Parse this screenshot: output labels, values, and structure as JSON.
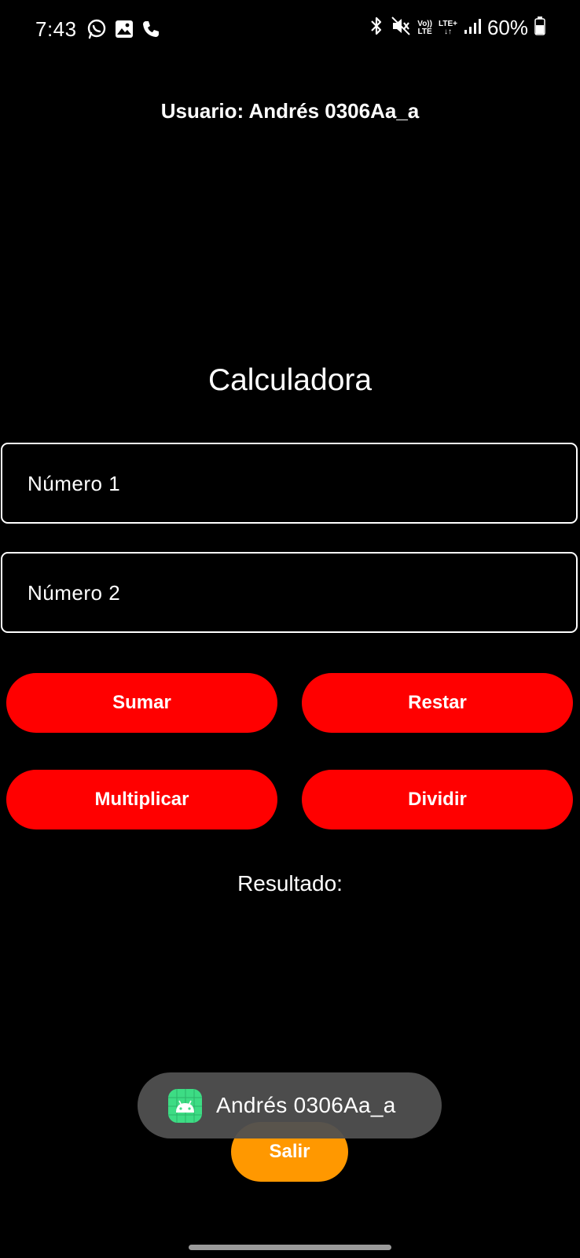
{
  "status_bar": {
    "time": "7:43",
    "left_icons": [
      "whatsapp-icon",
      "gallery-icon",
      "phone-icon"
    ],
    "right_icons": [
      "bluetooth-icon",
      "mute-icon",
      "volte-icon",
      "lte-plus-icon",
      "signal-icon",
      "battery-icon"
    ],
    "volte_label_top": "Vo))",
    "volte_label_bottom": "LTE",
    "lte_label_top": "LTE+",
    "lte_label_bottom": "↓↑",
    "battery": "60%"
  },
  "header": {
    "user_line": "Usuario: Andrés 0306Aa_a"
  },
  "main": {
    "title": "Calculadora",
    "number1_placeholder": "Número 1",
    "number2_placeholder": "Número 2",
    "buttons": {
      "sumar": "Sumar",
      "restar": "Restar",
      "multiplicar": "Multiplicar",
      "dividir": "Dividir"
    },
    "result_label": "Resultado:",
    "exit_label": "Salir"
  },
  "toast": {
    "text": "Andrés 0306Aa_a",
    "icon": "android-app-icon"
  },
  "colors": {
    "background": "#000000",
    "operation_button": "#ff0000",
    "exit_button": "#ff9800",
    "toast_background": "#505050",
    "toast_icon": "#3ddc84"
  }
}
